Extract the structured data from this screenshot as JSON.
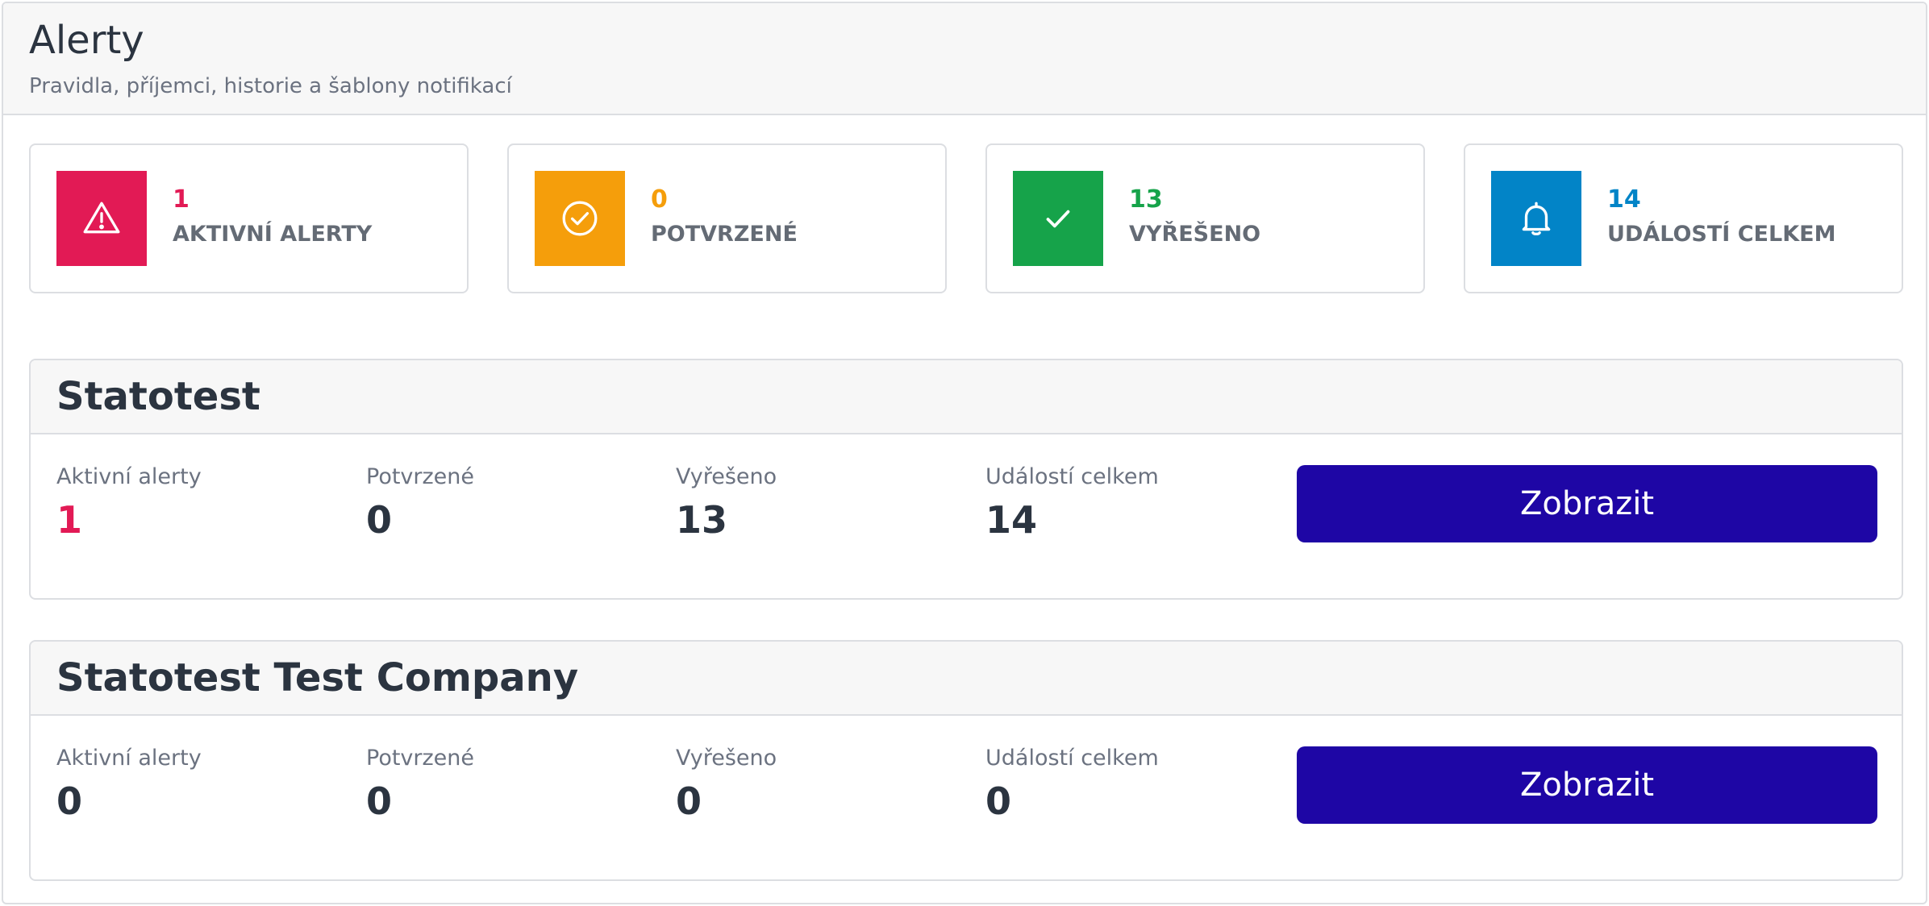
{
  "header": {
    "title": "Alerty",
    "subtitle": "Pravidla, příjemci, historie a šablony notifikací"
  },
  "summary": [
    {
      "value": "1",
      "label": "AKTIVNÍ ALERTY",
      "color": "#e21a55",
      "icon": "warning-icon"
    },
    {
      "value": "0",
      "label": "POTVRZENÉ",
      "color": "#f59e0b",
      "icon": "check-circle-icon"
    },
    {
      "value": "13",
      "label": "VYŘEŠENO",
      "color": "#16a34a",
      "icon": "check-icon"
    },
    {
      "value": "14",
      "label": "UDÁLOSTÍ CELKEM",
      "color": "#0284c7",
      "icon": "bell-icon"
    }
  ],
  "labels": {
    "active": "Aktivní alerty",
    "confirmed": "Potvrzené",
    "resolved": "Vyřešeno",
    "total": "Událostí celkem",
    "show_button": "Zobrazit"
  },
  "groups": [
    {
      "name": "Statotest",
      "active": "1",
      "confirmed": "0",
      "resolved": "13",
      "total": "14"
    },
    {
      "name": "Statotest Test Company",
      "active": "0",
      "confirmed": "0",
      "resolved": "0",
      "total": "0"
    }
  ],
  "colors": {
    "active_highlight": "#e21a55",
    "button": "#1e06a5"
  }
}
